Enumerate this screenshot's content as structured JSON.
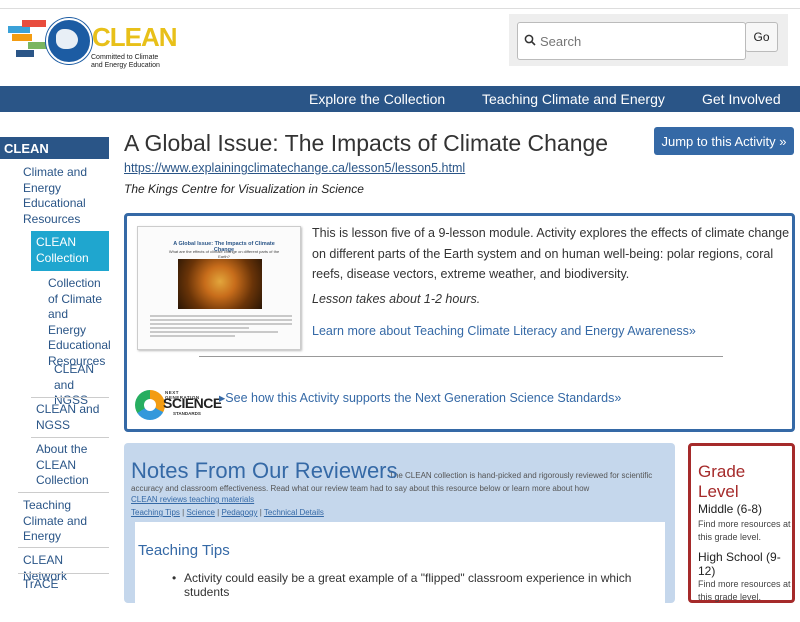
{
  "header": {
    "logo_word": "CLEAN",
    "logo_tagline": "Committed to Climate and Energy Education",
    "search_placeholder": "Search",
    "go_label": "Go"
  },
  "nav": {
    "items": [
      "Explore the Collection",
      "Teaching Climate and Energy",
      "Get Involved"
    ]
  },
  "sidebar": {
    "heading": "CLEAN",
    "items": [
      "Climate and Energy Educational Resources",
      "CLEAN Collection",
      "Collection of Climate and Energy Educational Resources",
      "CLEAN and NGSS",
      "CLEAN and NGSS",
      "About the CLEAN Collection",
      "Teaching Climate and Energy",
      "CLEAN Network",
      "TrACE"
    ]
  },
  "resource": {
    "title": "A Global Issue: The Impacts of Climate Change",
    "url": "https://www.explainingclimatechange.ca/lesson5/lesson5.html",
    "organization": "The Kings Centre for Visualization in Science",
    "jump_label": "Jump to this Activity »",
    "thumbnail_title": "A Global Issue: The Impacts of Climate Change",
    "thumbnail_subtitle": "What are the effects of climate change on different parts of the Earth?",
    "description": "This is lesson five of a 9-lesson module. Activity explores the effects of climate change on different parts of the Earth system and on human well-being: polar regions, coral reefs, disease vectors, extreme weather, and biodiversity.",
    "length": "Lesson takes about 1-2 hours.",
    "learn_more": "Learn more about Teaching Climate Literacy and Energy Awareness»",
    "ngss_logo": {
      "top": "NEXT GENERATION",
      "main": "SCIENCE",
      "bottom": "STANDARDS"
    },
    "ngss_link": "▸See how this Activity supports the Next Generation Science Standards»"
  },
  "notes": {
    "heading": "Notes From Our Reviewers",
    "intro": "The CLEAN collection is hand-picked and rigorously reviewed for scientific accuracy and classroom effectiveness. Read what our review team had to say about this resource below or learn more about how",
    "intro_link": "CLEAN reviews teaching materials",
    "links": [
      "Teaching Tips",
      "Science",
      "Pedagogy",
      "Technical Details"
    ],
    "tips_heading": "Teaching Tips",
    "tip_1": "Activity could easily be a great example of a \"flipped\" classroom experience in which students"
  },
  "grade": {
    "heading": "Grade Level",
    "level_1": "Middle (6-8)",
    "level_1_note": "Find more resources at this grade level.",
    "level_2": "High School (9-12)",
    "level_2_note": "Find more resources at this grade level."
  },
  "colors": {
    "nav_blue": "#2a5587",
    "accent_blue": "#3569a6",
    "selected_cyan": "#1fa6cf",
    "notes_bg": "#c5d7ec",
    "grade_red": "#a52a2a"
  }
}
